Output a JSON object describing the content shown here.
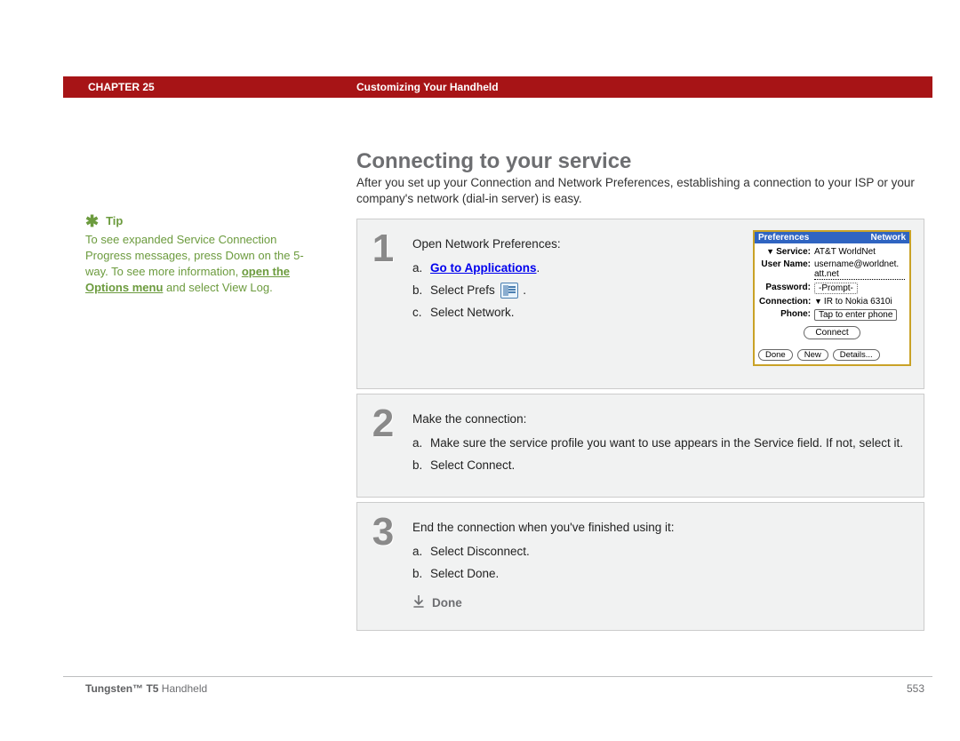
{
  "header": {
    "chapter": "CHAPTER 25",
    "title": "Customizing Your Handheld"
  },
  "page_title": "Connecting to your service",
  "intro": "After you set up your Connection and Network Preferences, establishing a connection to your ISP or your company's network (dial-in server) is easy.",
  "tip": {
    "label": "Tip",
    "text_pre": "To see expanded Service Connection Progress messages, press Down on the 5-way. To see more information, ",
    "link": "open the Options menu",
    "text_post": " and select View Log."
  },
  "steps": [
    {
      "num": "1",
      "lead": "Open Network Preferences:",
      "subs": [
        {
          "letter": "a.",
          "link": "Go to Applications",
          "tail": "."
        },
        {
          "letter": "b.",
          "text": "Select Prefs",
          "has_icon": true,
          "tail": " ."
        },
        {
          "letter": "c.",
          "text": "Select Network."
        }
      ],
      "palm": {
        "title_left": "Preferences",
        "title_right": "Network",
        "service_label": "Service:",
        "service_value": "AT&T WorldNet",
        "user_label": "User Name:",
        "user_value_1": "username@worldnet.",
        "user_value_2": "att.net",
        "password_label": "Password:",
        "password_value": "-Prompt-",
        "conn_label": "Connection:",
        "conn_value": "IR to Nokia 6310i",
        "phone_label": "Phone:",
        "phone_value": "Tap to enter phone",
        "connect": "Connect",
        "buttons": [
          "Done",
          "New",
          "Details..."
        ]
      }
    },
    {
      "num": "2",
      "lead": "Make the connection:",
      "subs": [
        {
          "letter": "a.",
          "text": "Make sure the service profile you want to use appears in the Service field. If not, select it."
        },
        {
          "letter": "b.",
          "text": "Select Connect."
        }
      ]
    },
    {
      "num": "3",
      "lead": "End the connection when you've finished using it:",
      "subs": [
        {
          "letter": "a.",
          "text": "Select Disconnect."
        },
        {
          "letter": "b.",
          "text": "Select Done."
        }
      ],
      "done": "Done"
    }
  ],
  "footer": {
    "product_bold": "Tungsten™ T5",
    "product_rest": " Handheld",
    "page": "553"
  }
}
